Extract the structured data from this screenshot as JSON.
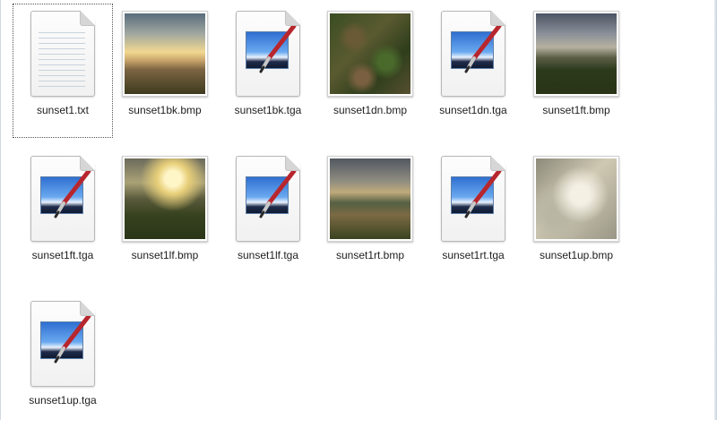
{
  "files": [
    {
      "name": "sunset1.txt",
      "type": "txt",
      "icon": "text-document-icon",
      "selected": true
    },
    {
      "name": "sunset1bk.bmp",
      "type": "bmp",
      "icon": "image-thumbnail"
    },
    {
      "name": "sunset1bk.tga",
      "type": "tga",
      "icon": "paint-document-icon"
    },
    {
      "name": "sunset1dn.bmp",
      "type": "bmp",
      "icon": "image-thumbnail"
    },
    {
      "name": "sunset1dn.tga",
      "type": "tga",
      "icon": "paint-document-icon"
    },
    {
      "name": "sunset1ft.bmp",
      "type": "bmp",
      "icon": "image-thumbnail"
    },
    {
      "name": "sunset1ft.tga",
      "type": "tga",
      "icon": "paint-document-icon"
    },
    {
      "name": "sunset1lf.bmp",
      "type": "bmp",
      "icon": "image-thumbnail"
    },
    {
      "name": "sunset1lf.tga",
      "type": "tga",
      "icon": "paint-document-icon"
    },
    {
      "name": "sunset1rt.bmp",
      "type": "bmp",
      "icon": "image-thumbnail"
    },
    {
      "name": "sunset1rt.tga",
      "type": "tga",
      "icon": "paint-document-icon"
    },
    {
      "name": "sunset1up.bmp",
      "type": "bmp",
      "icon": "image-thumbnail"
    },
    {
      "name": "sunset1up.tga",
      "type": "tga",
      "icon": "paint-document-icon"
    }
  ],
  "colors": {
    "selection_outline": "#555555",
    "label_text": "#1e1e1e",
    "background": "#ffffff"
  }
}
